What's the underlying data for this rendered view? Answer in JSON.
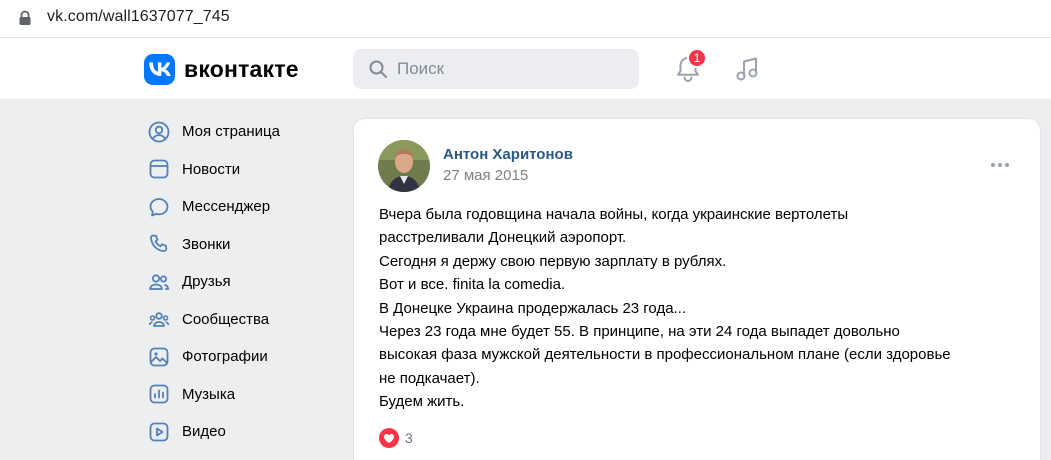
{
  "browser": {
    "url": "vk.com/wall1637077_745"
  },
  "header": {
    "logo_text": "вконтакте",
    "search_placeholder": "Поиск",
    "notifications_count": "1",
    "accent_color": "#0077ff",
    "badge_color": "#ff3347"
  },
  "sidebar": {
    "items": [
      {
        "label": "Моя страница",
        "icon": "user-circle-icon"
      },
      {
        "label": "Новости",
        "icon": "newsfeed-icon"
      },
      {
        "label": "Мессенджер",
        "icon": "message-icon"
      },
      {
        "label": "Звонки",
        "icon": "phone-icon"
      },
      {
        "label": "Друзья",
        "icon": "friends-icon"
      },
      {
        "label": "Сообщества",
        "icon": "communities-icon"
      },
      {
        "label": "Фотографии",
        "icon": "photo-icon"
      },
      {
        "label": "Музыка",
        "icon": "music-icon"
      },
      {
        "label": "Видео",
        "icon": "video-icon"
      }
    ]
  },
  "post": {
    "author": "Антон Харитонов",
    "date": "27 мая 2015",
    "lines": [
      "Вчера была годовщина начала войны, когда украинские вертолеты",
      "расстреливали Донецкий аэропорт.",
      "Сегодня я держу свою первую зарплату в рублях.",
      "Вот и все. finita la comedia.",
      "В Донецке Украина продержалась 23 года...",
      "Через 23 года мне будет 55. В принципе, на эти 24 года выпадет довольно",
      "высокая фаза мужской деятельности в профессиональном плане (если здоровье",
      "не подкачает).",
      "Будем жить."
    ],
    "likes_count": "3",
    "like_color": "#ff3347",
    "author_color": "#2a5885"
  }
}
